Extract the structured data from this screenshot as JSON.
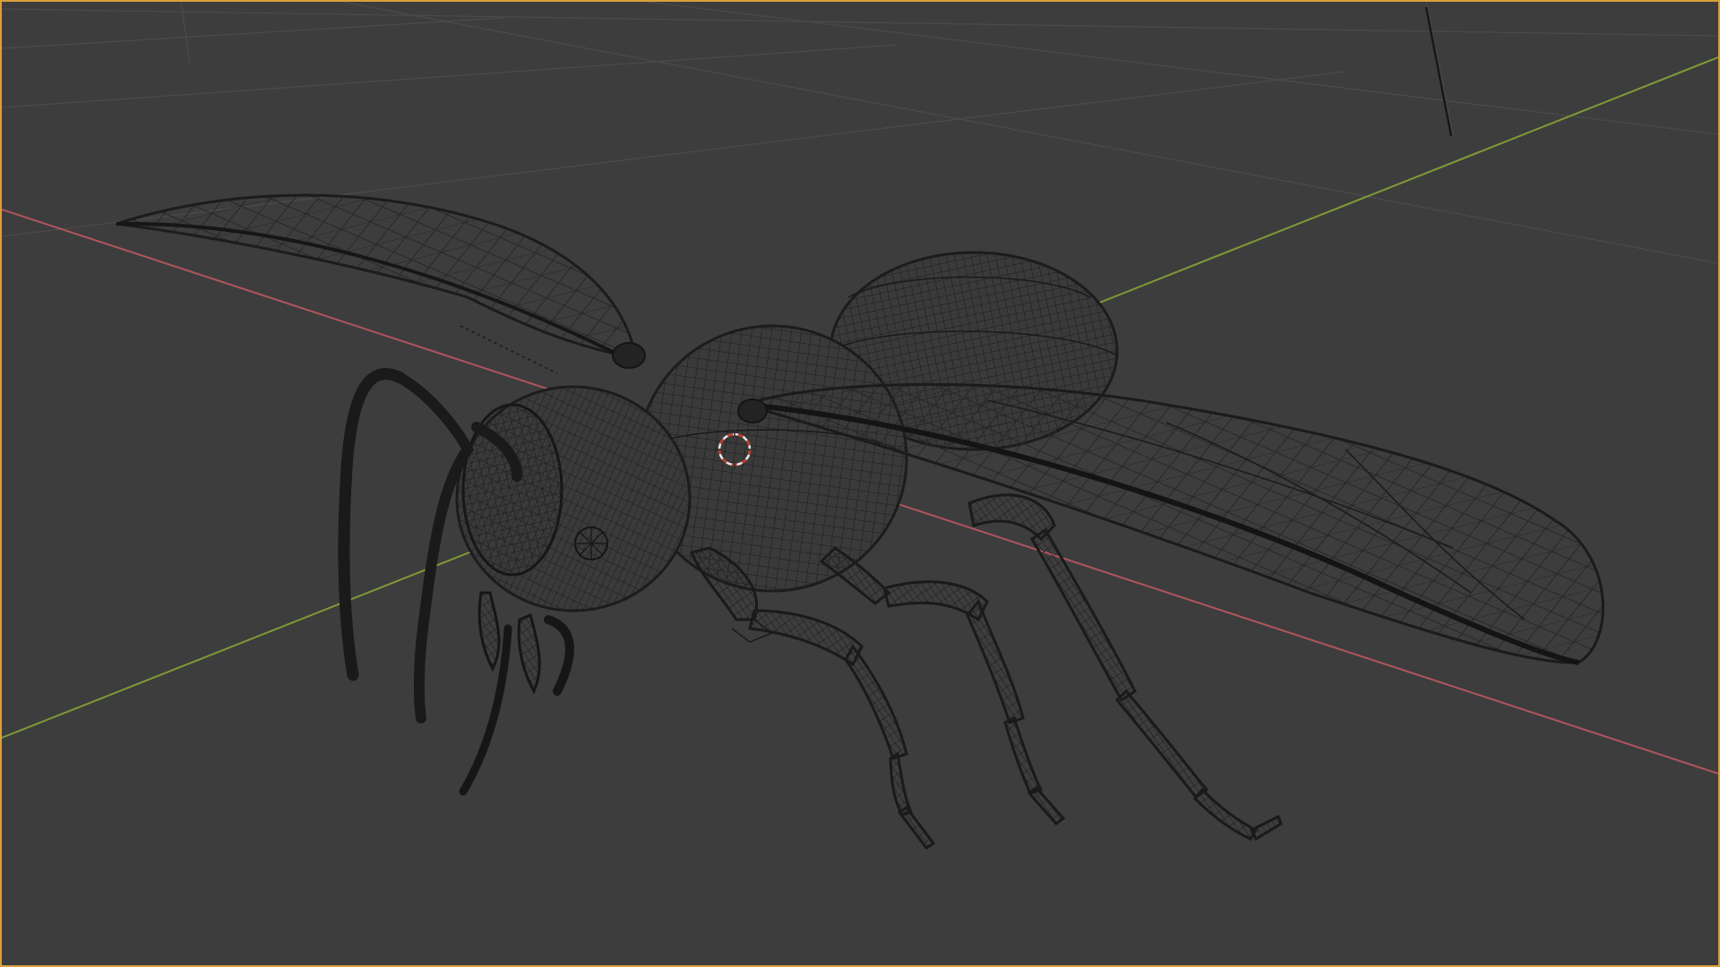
{
  "viewport": {
    "label": "3D viewport",
    "mode": "wireframe",
    "background_color": "#3d3d3d",
    "active_border_color": "#d9a03a"
  },
  "colors": {
    "grid_line": "#4a4a4a",
    "x_axis": "#b0555f",
    "y_axis": "#7f9a36",
    "wire": "#1e1e1e",
    "wire_dense": "#181818",
    "cursor_red": "#c0392b",
    "cursor_white": "#e8e8e8"
  },
  "scene": {
    "object": "wasp",
    "shading": "wireframe",
    "cursor_icon": "3d-cursor-icon"
  }
}
